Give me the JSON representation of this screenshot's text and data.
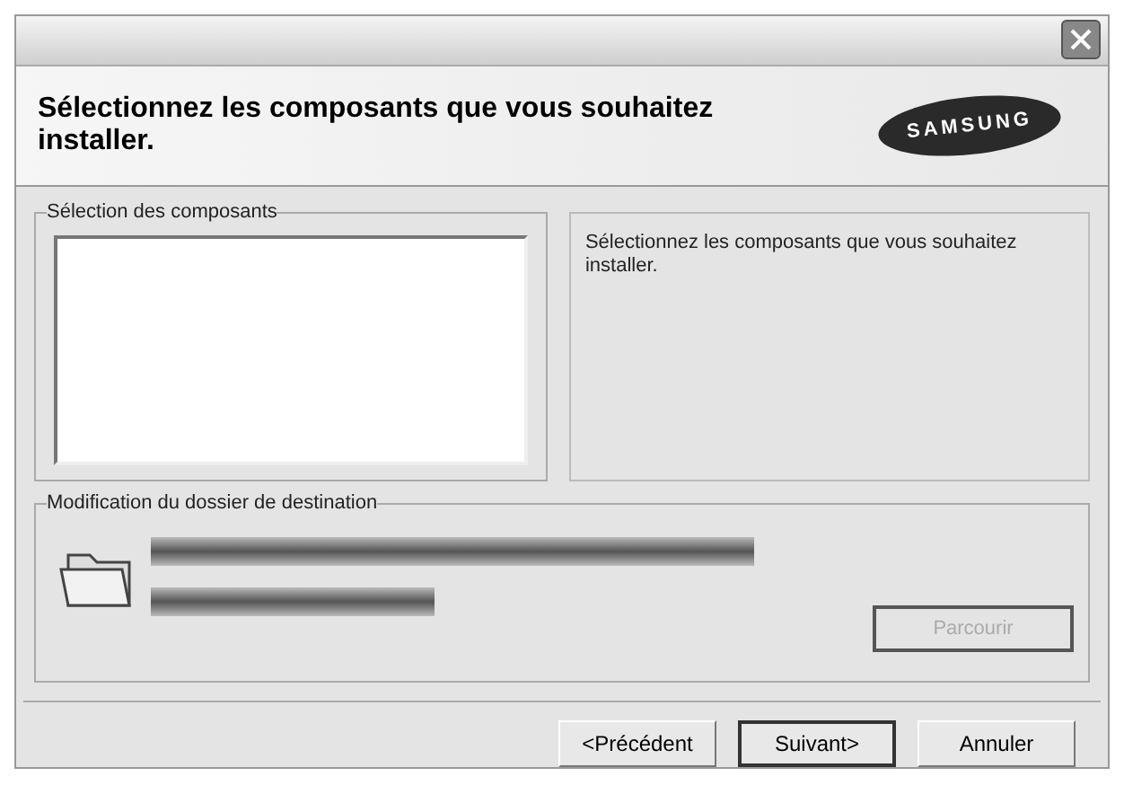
{
  "header": {
    "title": "Sélectionnez les composants que vous souhaitez installer.",
    "logo": "SAMSUNG"
  },
  "components": {
    "label": "Sélection des composants",
    "description": "Sélectionnez les composants que vous souhaitez installer."
  },
  "destination": {
    "label": "Modification du dossier de destination",
    "browse": {
      "label": "Parcourir",
      "disabled": true
    }
  },
  "buttons": [
    {
      "label": "<Précédent",
      "default": false
    },
    {
      "label": "Suivant>",
      "default": true
    },
    {
      "label": "Annuler",
      "default": false
    }
  ]
}
